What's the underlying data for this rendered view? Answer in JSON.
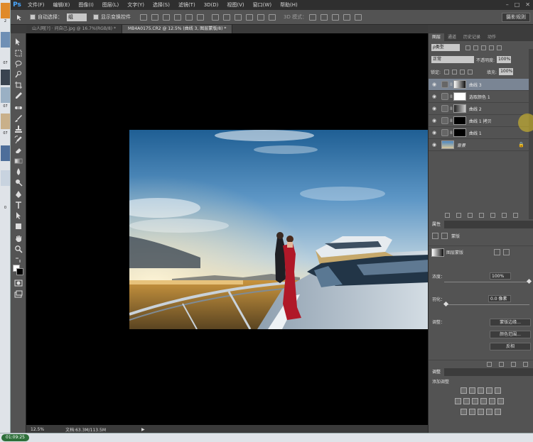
{
  "app": {
    "logo": "Ps",
    "menus": [
      "文件(F)",
      "编辑(E)",
      "图像(I)",
      "图层(L)",
      "文字(Y)",
      "选择(S)",
      "滤镜(T)",
      "3D(D)",
      "视图(V)",
      "窗口(W)",
      "帮助(H)"
    ],
    "window_controls": [
      "–",
      "□",
      "✕"
    ]
  },
  "options_bar": {
    "auto_select_label": "自动选择：",
    "auto_select_value": "组",
    "transform_label": "显示变换控件",
    "mode_3d_label": "3D 模式：",
    "workspace_button": "摄影规则"
  },
  "tabs": [
    {
      "label": "山人网[?] · 问自己.jpg @ 16.7%(RGB/8) *",
      "active": false
    },
    {
      "label": "MB4A0175.CR2 @ 12.5% (曲线 3, 图层蒙版/8) *",
      "active": true
    }
  ],
  "statusbar": {
    "zoom": "12.5%",
    "doc": "文档:63.3M/113.5M"
  },
  "layers_panel": {
    "tabs": [
      "图层",
      "通道",
      "历史记录",
      "动作"
    ],
    "kind_label": "ρ类型",
    "blend_mode": "正常",
    "opacity_label": "不透明度:",
    "opacity_value": "100%",
    "lock_label": "锁定:",
    "fill_label": "填充:",
    "fill_value": "100%",
    "layers": [
      {
        "name": "曲线 3",
        "selected": true,
        "mask": "dark-light"
      },
      {
        "name": "选取颜色 1",
        "selected": false,
        "mask": "white"
      },
      {
        "name": "曲线 2",
        "selected": false,
        "mask": "dark-light"
      },
      {
        "name": "曲线 1 拷贝",
        "selected": false,
        "mask": "black"
      },
      {
        "name": "曲线 1",
        "selected": false,
        "mask": "black"
      },
      {
        "name": "背景",
        "selected": false,
        "mask": "photo"
      }
    ]
  },
  "properties_panel": {
    "tab": "属性",
    "title": "蒙版",
    "mask_label": "图层蒙版",
    "density_label": "浓度：",
    "density_value": "100%",
    "feather_label": "羽化：",
    "feather_value": "0.0 像素",
    "adjust_label": "调整：",
    "btn_edge": "蒙版边缘...",
    "btn_color": "颜色范围...",
    "btn_invert": "反相"
  },
  "adjustments_panel": {
    "tab": "调整",
    "add_label": "添加调整"
  },
  "taskbar": {
    "timer": "01:09:25"
  },
  "desktop_labels": [
    "2",
    "07",
    "0",
    "07",
    "0",
    "07",
    "0",
    "0"
  ]
}
